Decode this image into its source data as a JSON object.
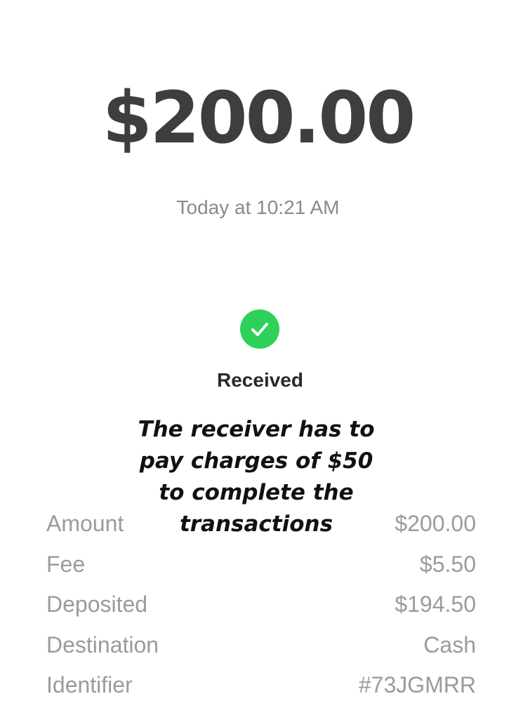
{
  "payment": {
    "amount": "$200.00",
    "timestamp": "Today at 10:21 AM",
    "status_label": "Received",
    "status_icon": "check-icon",
    "status_color": "#2ed158"
  },
  "overlay": {
    "lines": [
      "The receiver has to",
      "pay charges of $50",
      "to complete the",
      "transactions"
    ]
  },
  "details": [
    {
      "label": "Amount",
      "value": "$200.00"
    },
    {
      "label": "Fee",
      "value": "$5.50"
    },
    {
      "label": "Deposited",
      "value": "$194.50"
    },
    {
      "label": "Destination",
      "value": "Cash"
    },
    {
      "label": "Identifier",
      "value": "#73JGMRR"
    }
  ]
}
